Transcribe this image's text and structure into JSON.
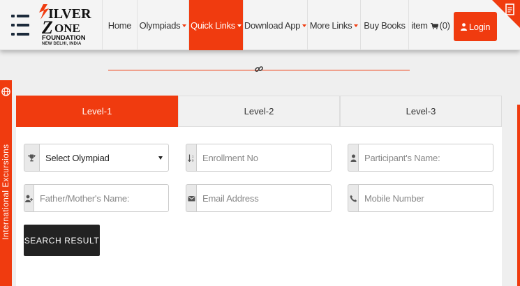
{
  "brand": {
    "logo_text": "SILVER ZONE FOUNDATION",
    "logo_subtitle": "NEW DELHI, INDIA",
    "accent_color": "#f03b0f"
  },
  "nav": {
    "items": [
      {
        "label": "Home",
        "dropdown": false,
        "active": false
      },
      {
        "label": "Olympiads",
        "dropdown": true,
        "active": false
      },
      {
        "label": "Quick Links",
        "dropdown": true,
        "active": true
      },
      {
        "label": "Download App",
        "dropdown": true,
        "active": false
      },
      {
        "label": "More Links",
        "dropdown": true,
        "active": false
      },
      {
        "label": "Buy Books",
        "dropdown": false,
        "active": false
      }
    ],
    "cart_label": "item",
    "cart_count": "(0)",
    "login_label": "Login"
  },
  "side_tab": {
    "label": "International Excursions"
  },
  "levels": {
    "tabs": [
      "Level-1",
      "Level-2",
      "Level-3"
    ],
    "active_index": 0
  },
  "form": {
    "olympiad_select": {
      "value": "Select Olympiad"
    },
    "enrollment": {
      "placeholder": "Enrollment No"
    },
    "participant": {
      "placeholder": "Participant's Name:"
    },
    "parent": {
      "placeholder": "Father/Mother's Name:"
    },
    "email": {
      "placeholder": "Email Address"
    },
    "mobile": {
      "placeholder": "Mobile Number"
    },
    "search_button": "SEARCH RESULT"
  },
  "icons": {
    "menu": "hamburger-icon",
    "cart": "cart-icon",
    "user": "user-icon",
    "link": "link-icon",
    "globe": "globe-icon",
    "trophy": "trophy-icon",
    "sort": "sort-numeric-icon",
    "person": "person-icon",
    "user_plus": "user-plus-icon",
    "envelope": "envelope-icon",
    "phone": "phone-icon"
  }
}
